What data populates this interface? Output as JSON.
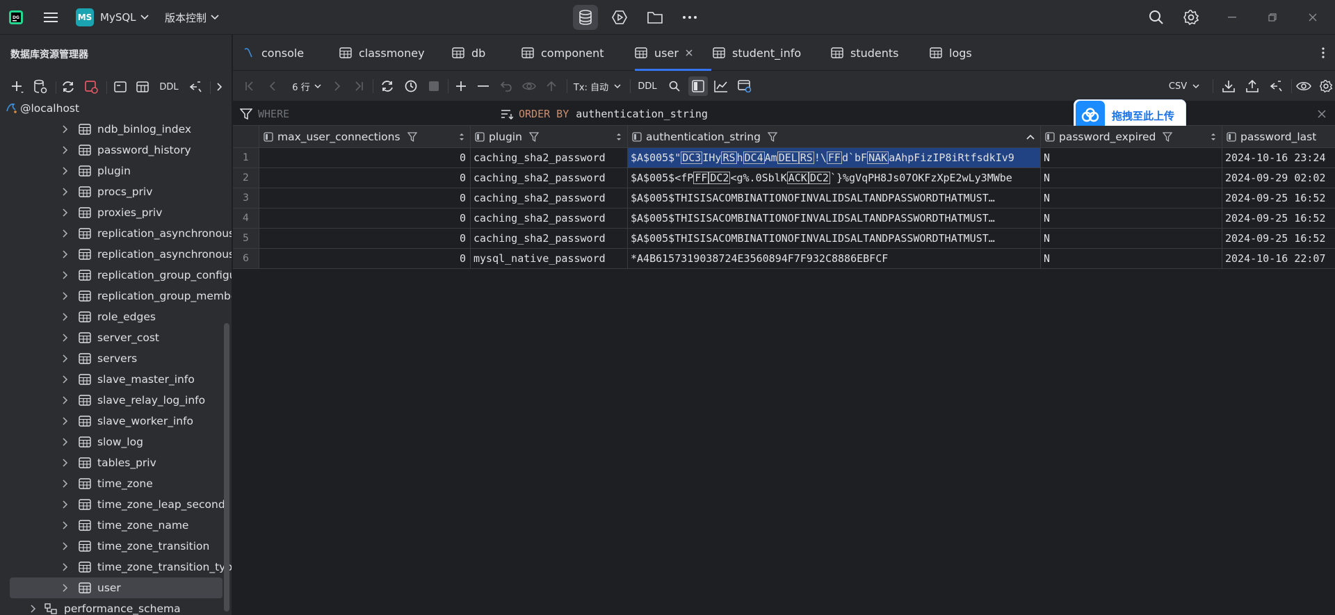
{
  "titlebar": {
    "project_initials": "MS",
    "project_name": "MySQL",
    "vcs_label": "版本控制"
  },
  "sidebar": {
    "title": "数据库资源管理器",
    "toolbar": {
      "ddl_label": "DDL"
    },
    "root": "@localhost",
    "items": [
      "ndb_binlog_index",
      "password_history",
      "plugin",
      "procs_priv",
      "proxies_priv",
      "replication_asynchronous_c",
      "replication_asynchronous_c",
      "replication_group_configur",
      "replication_group_member",
      "role_edges",
      "server_cost",
      "servers",
      "slave_master_info",
      "slave_relay_log_info",
      "slave_worker_info",
      "slow_log",
      "tables_priv",
      "time_zone",
      "time_zone_leap_second",
      "time_zone_name",
      "time_zone_transition",
      "time_zone_transition_type",
      "user"
    ],
    "selected_item": "user",
    "schema_item": "performance_schema"
  },
  "tabs": [
    {
      "label": "console",
      "icon": "console-icon"
    },
    {
      "label": "classmoney",
      "icon": "table-icon"
    },
    {
      "label": "db",
      "icon": "table-icon"
    },
    {
      "label": "component",
      "icon": "table-icon"
    },
    {
      "label": "user",
      "icon": "table-icon",
      "active": true
    },
    {
      "label": "student_info",
      "icon": "table-icon"
    },
    {
      "label": "students",
      "icon": "table-icon"
    },
    {
      "label": "logs",
      "icon": "table-icon"
    }
  ],
  "data_toolbar": {
    "rows_label": "6 行",
    "tx_label": "Tx: 自动",
    "ddl_label": "DDL",
    "export_format": "CSV"
  },
  "filter": {
    "where_label": "WHERE",
    "order_keyword": "ORDER BY",
    "order_value": "authentication_string"
  },
  "upload_badge": {
    "label": "拖拽至此上传"
  },
  "grid": {
    "columns": [
      "max_user_connections",
      "plugin",
      "authentication_string",
      "password_expired",
      "password_last"
    ],
    "rows": [
      {
        "n": "1",
        "max_user_connections": "0",
        "plugin": "caching_sha2_password",
        "auth_parts": [
          [
            "$A$005$\"",
            0
          ],
          [
            "DC3",
            1
          ],
          [
            "IHy",
            0
          ],
          [
            "RS",
            1
          ],
          [
            "h",
            0
          ],
          [
            "DC4",
            1
          ],
          [
            "Am",
            0
          ],
          [
            "DEL",
            1
          ],
          [
            "RS",
            1
          ],
          [
            "!\\",
            0
          ],
          [
            "FF",
            1
          ],
          [
            "d`bF",
            0
          ],
          [
            "NAK",
            1
          ],
          [
            "aAhpFizIP8iRtfsdkIv9",
            0
          ]
        ],
        "password_expired": "N",
        "password_last": "2024-10-16 23:24"
      },
      {
        "n": "2",
        "max_user_connections": "0",
        "plugin": "caching_sha2_password",
        "auth_parts": [
          [
            "$A$005$<fP",
            0
          ],
          [
            "FF",
            1
          ],
          [
            "DC2",
            1
          ],
          [
            "<g%.0SblK",
            0
          ],
          [
            "ACK",
            1
          ],
          [
            "DC2",
            1
          ],
          [
            "`}%gVqPH8Js07OKFzXpE2wLy3MWbe",
            0
          ]
        ],
        "password_expired": "N",
        "password_last": "2024-09-29 02:02"
      },
      {
        "n": "3",
        "max_user_connections": "0",
        "plugin": "caching_sha2_password",
        "auth_parts": [
          [
            "$A$005$THISISACOMBINATIONOFINVALIDSALTANDPASSWORDTHATMUST…",
            0
          ]
        ],
        "password_expired": "N",
        "password_last": "2024-09-25 16:52"
      },
      {
        "n": "4",
        "max_user_connections": "0",
        "plugin": "caching_sha2_password",
        "auth_parts": [
          [
            "$A$005$THISISACOMBINATIONOFINVALIDSALTANDPASSWORDTHATMUST…",
            0
          ]
        ],
        "password_expired": "N",
        "password_last": "2024-09-25 16:52"
      },
      {
        "n": "5",
        "max_user_connections": "0",
        "plugin": "caching_sha2_password",
        "auth_parts": [
          [
            "$A$005$THISISACOMBINATIONOFINVALIDSALTANDPASSWORDTHATMUST…",
            0
          ]
        ],
        "password_expired": "N",
        "password_last": "2024-09-25 16:52"
      },
      {
        "n": "6",
        "max_user_connections": "0",
        "plugin": "mysql_native_password",
        "auth_parts": [
          [
            "*A4B6157319038724E3560894F7F932C8886EBFCF",
            0
          ]
        ],
        "password_expired": "N",
        "password_last": "2024-10-16 22:07"
      }
    ]
  },
  "colors": {
    "accent": "#3574f0",
    "selection": "#214283",
    "keyword": "#cf8e6d"
  }
}
